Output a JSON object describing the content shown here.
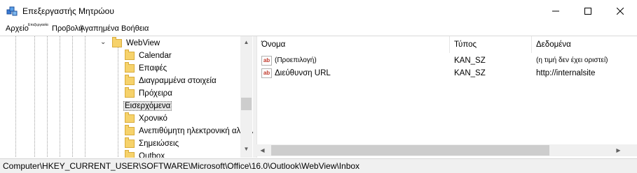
{
  "window": {
    "title": "Επεξεργαστής Μητρώου",
    "icon": "registry-editor-icon",
    "controls": [
      "minimize-icon",
      "maximize-icon",
      "close-icon"
    ]
  },
  "menu": {
    "items": [
      "Αρχείο",
      "Επεξεργασία",
      "Προβολή",
      "Αγαπημένα",
      "Βοήθεια"
    ]
  },
  "tree": {
    "parent": "WebView",
    "children": [
      "Calendar",
      "Επαφές",
      "Διαγραμμένα στοιχεία",
      "Πρόχειρα",
      "Εισερχόμενα",
      "Χρονικό",
      "Ανεπιθύμητη ηλεκτρονική αλληλογραφία",
      "Σημειώσεις",
      "Outbox"
    ],
    "selected": "Εισερχόμενα"
  },
  "list": {
    "columns": [
      "Όνομα",
      "Τύπος",
      "Δεδομένα"
    ],
    "rows": [
      {
        "name": "(Προεπιλογή)",
        "type": "KAN_SZ",
        "data": "(η τιμή δεν έχει οριστεί)",
        "icon": "string-value-icon"
      },
      {
        "name": "Διεύθυνση URL",
        "type": "KAN_SZ",
        "data": "http://internalsite",
        "icon": "string-value-icon"
      }
    ]
  },
  "status": {
    "path": "Computer\\HKEY_CURRENT_USER\\SOFTWARE\\Microsoft\\Office\\16.0\\Outlook\\WebView\\Inbox"
  },
  "colors": {
    "folder": "#f6d26b",
    "selection": "#e5e5e5",
    "scrollbar": "#f0f0f0",
    "string_icon": "#c0392b"
  }
}
